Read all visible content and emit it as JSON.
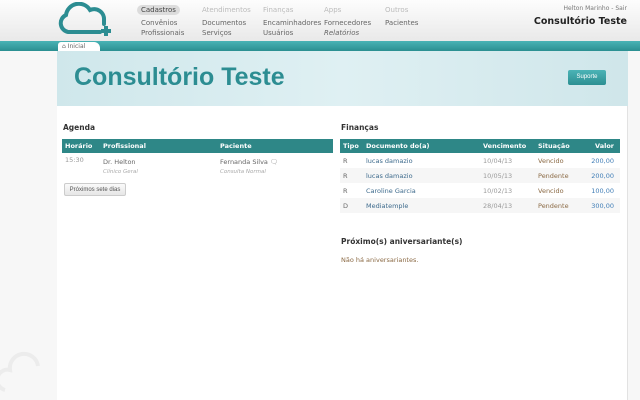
{
  "header": {
    "nav": [
      {
        "title": "Cadastros",
        "active": true,
        "items": [
          "Convênios",
          "Profissionais"
        ]
      },
      {
        "title": "Atendimentos",
        "items": [
          "Documentos",
          "Serviços"
        ]
      },
      {
        "title": "Finanças",
        "items": [
          "Encaminhadores",
          "Usuários"
        ]
      },
      {
        "title": "Apps",
        "items": [
          "Fornecedores",
          "Relatórios"
        ]
      },
      {
        "title": "Outros",
        "items": [
          "Pacientes"
        ]
      }
    ],
    "user": "Helton Marinho - Sair",
    "clinic": "Consultório Teste"
  },
  "tab": "Inicial",
  "hero": {
    "title": "Consultório Teste",
    "support": "Suporte"
  },
  "agenda": {
    "title": "Agenda",
    "columns": [
      "Horário",
      "Profissional",
      "Paciente"
    ],
    "rows": [
      {
        "time": "15:30",
        "professional": "Dr. Helton",
        "specialty": "Clínico Geral",
        "patient": "Fernanda Silva",
        "type": "Consulta Normal"
      }
    ],
    "button": "Próximos sete dias"
  },
  "finance": {
    "title": "Finanças",
    "columns": [
      "Tipo",
      "Documento do(a)",
      "Vencimento",
      "Situação",
      "Valor"
    ],
    "rows": [
      [
        "R",
        "lucas damazio",
        "10/04/13",
        "Vencido",
        "200,00"
      ],
      [
        "R",
        "lucas damazio",
        "10/05/13",
        "Pendente",
        "200,00"
      ],
      [
        "R",
        "Caroline Garcia",
        "10/02/13",
        "Vencido",
        "100,00"
      ],
      [
        "D",
        "Mediatemple",
        "28/04/13",
        "Pendente",
        "300,00"
      ]
    ]
  },
  "birthdays": {
    "title": "Próximo(s) aniversariante(s)",
    "empty": "Não há aniversariantes."
  }
}
